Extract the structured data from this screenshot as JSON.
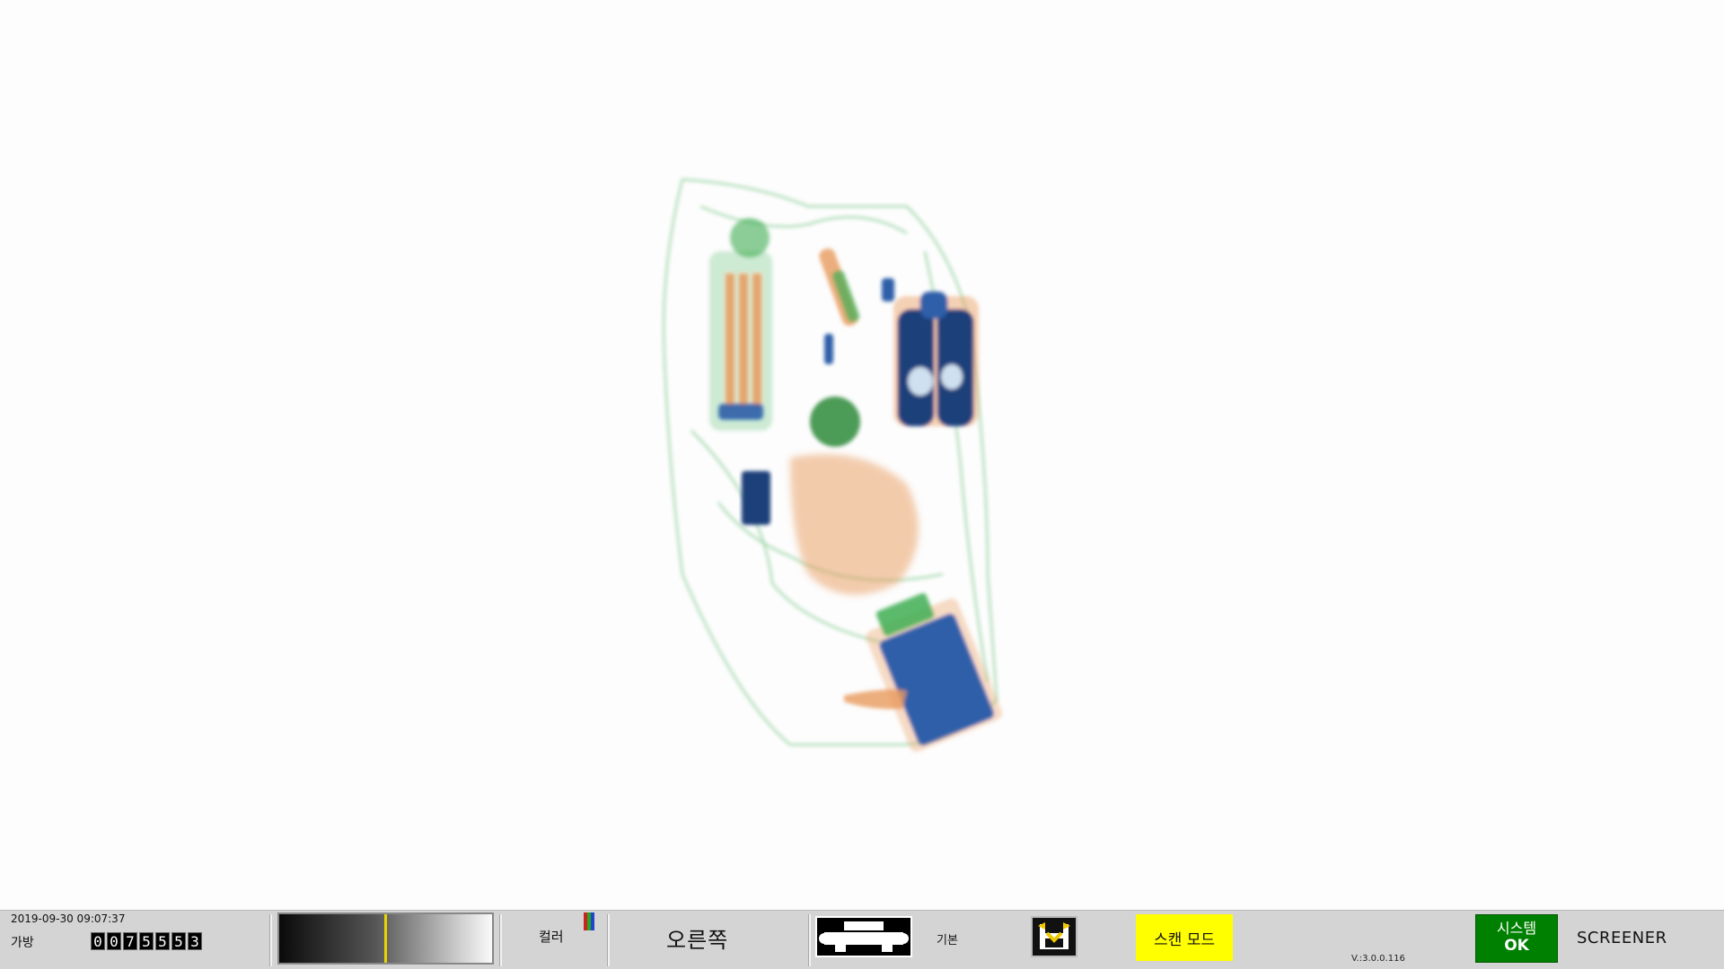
{
  "status": {
    "datetime": "2019-09-30 09:07:37",
    "bag_label": "가방",
    "bag_counter_digits": [
      "0",
      "0",
      "7",
      "5",
      "5",
      "5",
      "3"
    ],
    "color_label": "컬러",
    "color_swatches": [
      "#cc2222",
      "#22aa22",
      "#2244cc"
    ],
    "direction_label": "오른쪽",
    "default_label": "기본",
    "scan_mode_label": "스캔 모드",
    "version": "V.:3.0.0.116",
    "system_line1": "시스템",
    "system_line2": "OK",
    "user_role": "SCREENER"
  },
  "colors": {
    "organic": "#e89a5c",
    "inorganic": "#2e5fa8",
    "mixed": "#3fae54",
    "statusbar": "#d4d4d4",
    "scan_mode": "#ffff00",
    "system_ok": "#008000"
  }
}
